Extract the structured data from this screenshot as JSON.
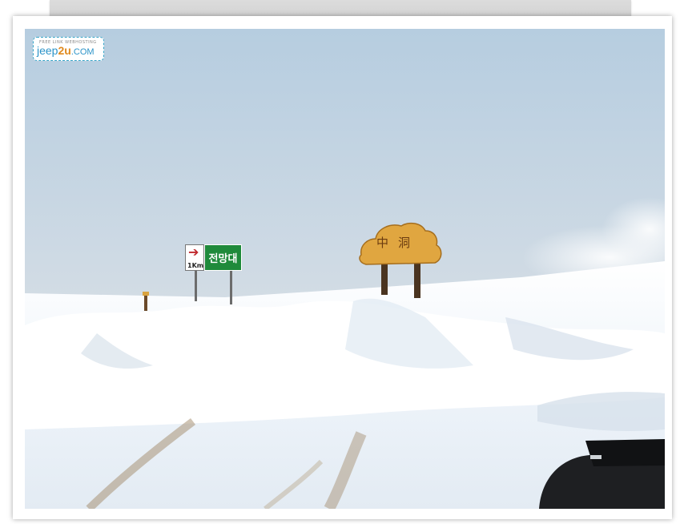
{
  "image": {
    "description_free": true
  },
  "watermark": {
    "small_text": "FREE LINK   WEBHOSTING",
    "brand_a": "jeep",
    "brand_b": "2u",
    "brand_c": ".COM"
  },
  "direction_sign": {
    "arrow": "➔",
    "distance": "1Km",
    "destination": "전망대"
  },
  "wooden_sign": {
    "text": "中洞"
  },
  "colors": {
    "sky_top": "#b9cfe0",
    "sky_bottom": "#e4e6e8",
    "snow": "#f4f8fc",
    "sign_green": "#1f8a3b",
    "wood": "#e0a640"
  }
}
